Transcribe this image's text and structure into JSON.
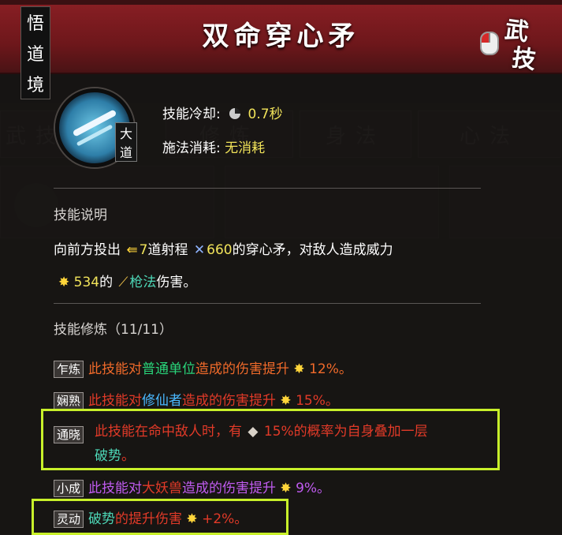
{
  "title": "双命穿心矛",
  "realm_label": [
    "悟",
    "道",
    "境"
  ],
  "category_label": [
    "武",
    "技"
  ],
  "tier_badge": [
    "大",
    "道"
  ],
  "background_tabs": [
    "武技",
    "修炼",
    "身法",
    "心法"
  ],
  "stats": {
    "cooldown_label": "技能冷却:",
    "cooldown_value": "0.7秒",
    "cost_label": "施法消耗:",
    "cost_value": "无消耗"
  },
  "description": {
    "heading": "技能说明",
    "line1_prefix": "向前方投出",
    "count_value": "7",
    "count_text": "道射程",
    "range_value": "660",
    "line1_suffix": "的穿心矛，对敌人造成威力",
    "power_value": "534",
    "line2_mid": "的",
    "damage_type": "枪法",
    "line2_suffix": "伤害。"
  },
  "training": {
    "heading": "技能修炼（11/11）",
    "items": [
      {
        "tag": "乍炼",
        "pre": "此技能对",
        "target": "普通单位",
        "post": "造成的伤害提升",
        "value": "12%。"
      },
      {
        "tag": "娴熟",
        "pre": "此技能对",
        "target": "修仙者",
        "post": "造成的伤害提升",
        "value": "15%。"
      },
      {
        "tag": "通晓",
        "line1": "此技能在命中敌人时，有",
        "value": "15%的概率为自身叠加一层",
        "line2": "破势",
        "line2_end": "。"
      },
      {
        "tag": "小成",
        "pre": "此技能对",
        "target": "大妖兽",
        "post": "造成的伤害提升",
        "value": "9%。"
      },
      {
        "tag": "灵动",
        "pre": "破势",
        "post": "的提升伤害",
        "value": "+2%。"
      }
    ]
  },
  "colors": {
    "title_bar": "#7a1a1e",
    "highlight_box": "#c8f02a",
    "value_yellow": "#f1e35a"
  }
}
